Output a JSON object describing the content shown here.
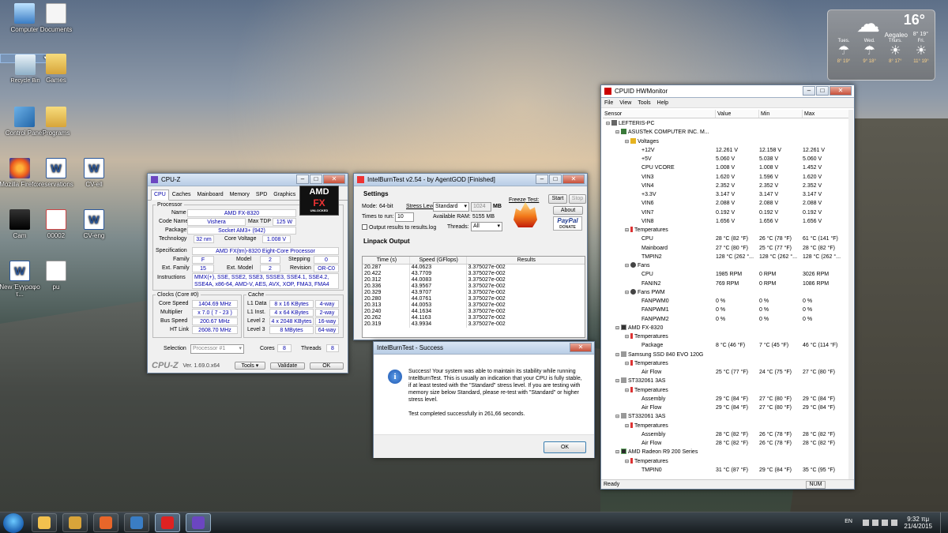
{
  "desktop": {
    "icons": [
      {
        "label": "Computer"
      },
      {
        "label": "Documents"
      },
      {
        "label": "Recycle Bin"
      },
      {
        "label": "Games"
      },
      {
        "label": "Control Panel"
      },
      {
        "label": "Programs"
      },
      {
        "label": "Mozilla Firefox"
      },
      {
        "label": "reservations"
      },
      {
        "label": "CV-ell"
      },
      {
        "label": "Cam"
      },
      {
        "label": "00002"
      },
      {
        "label": "CV-eng"
      },
      {
        "label": "New Έγγραφο τ..."
      },
      {
        "label": "pu"
      }
    ]
  },
  "weather": {
    "temp": "16°",
    "city": "Aegaleo",
    "minmax": "8° 19°",
    "days": [
      {
        "name": "Tues.",
        "temps": "8° 19°",
        "icon": "cloud-rain-icon"
      },
      {
        "name": "Wed.",
        "temps": "9° 18°",
        "icon": "cloud-rain-icon"
      },
      {
        "name": "Thurs.",
        "temps": "8° 17°",
        "icon": "sun-cloud-icon"
      },
      {
        "name": "Fri.",
        "temps": "11° 19°",
        "icon": "sun-cloud-icon"
      }
    ]
  },
  "cpuz": {
    "title": "CPU-Z",
    "tabs": [
      "CPU",
      "Caches",
      "Mainboard",
      "Memory",
      "SPD",
      "Graphics",
      "About"
    ],
    "processor_legend": "Processor",
    "labels": {
      "name": "Name",
      "codename": "Code Name",
      "maxtdp": "Max TDP",
      "package": "Package",
      "technology": "Technology",
      "corevoltage": "Core Voltage",
      "specification": "Specification",
      "family": "Family",
      "model": "Model",
      "stepping": "Stepping",
      "extfamily": "Ext. Family",
      "extmodel": "Ext. Model",
      "revision": "Revision",
      "instructions": "Instructions"
    },
    "values": {
      "name": "AMD FX-8320",
      "codename": "Vishera",
      "maxtdp": "125 W",
      "package": "Socket AM3+ (942)",
      "technology": "32 nm",
      "corevoltage": "1.008 V",
      "specification": "AMD FX(tm)-8320 Eight-Core Processor",
      "family": "F",
      "model": "2",
      "stepping": "0",
      "extfamily": "15",
      "extmodel": "2",
      "revision": "OR-C0",
      "instructions": "MMX(+), SSE, SSE2, SSE3, SSSE3, SSE4.1, SSE4.2, SSE4A, x86-64, AMD-V, AES, AVX, XOP, FMA3, FMA4"
    },
    "clocks_legend": "Clocks (Core #0)",
    "cache_legend": "Cache",
    "clocks": {
      "corespeed_label": "Core Speed",
      "corespeed": "1404.69 MHz",
      "multiplier_label": "Multiplier",
      "multiplier": "x 7.0 ( 7 - 23 )",
      "busspeed_label": "Bus Speed",
      "busspeed": "200.67 MHz",
      "htlink_label": "HT Link",
      "htlink": "2608.70 MHz"
    },
    "cache": {
      "l1d_label": "L1 Data",
      "l1d": "8 x 16 KBytes",
      "l1d_way": "4-way",
      "l1i_label": "L1 Inst.",
      "l1i": "4 x 64 KBytes",
      "l1i_way": "2-way",
      "l2_label": "Level 2",
      "l2": "4 x 2048 KBytes",
      "l2_way": "16-way",
      "l3_label": "Level 3",
      "l3": "8 MBytes",
      "l3_way": "64-way"
    },
    "selection_label": "Selection",
    "selection_value": "Processor #1",
    "cores_label": "Cores",
    "cores": "8",
    "threads_label": "Threads",
    "threads": "8",
    "brand": "CPU-Z",
    "version": "Ver. 1.69.0.x64",
    "tools_label": "Tools",
    "validate_label": "Validate",
    "ok_label": "OK",
    "logo_amd": "AMD",
    "logo_fx": "FX",
    "logo_sub": "UNLOCKED"
  },
  "ibt": {
    "title": "IntelBurnTest v2.54 - by AgentGOD [Finished]",
    "settings_title": "Settings",
    "mode_label": "Mode:",
    "mode_value": "64-bit",
    "stress_label": "Stress Level:",
    "stress_value": "Standard",
    "mem_value": "1024",
    "mem_unit": "MB",
    "times_label": "Times to run:",
    "times_value": "10",
    "ram_label": "Available RAM:",
    "ram_value": "5155 MB",
    "threads_label": "Threads:",
    "threads_value": "All",
    "output_check_label": "Output results to results.log",
    "freeze_label": "Freeze Test:",
    "start_label": "Start",
    "stop_label": "Stop",
    "about_label": "About",
    "paypal_label": "PayPal",
    "donate_label": "DONATE",
    "linpack_title": "Linpack Output",
    "columns": [
      "Time (s)",
      "Speed (GFlops)",
      "Results"
    ],
    "rows": [
      [
        "20.287",
        "44.0623",
        "3.375027e-002"
      ],
      [
        "20.422",
        "43.7709",
        "3.375027e-002"
      ],
      [
        "20.312",
        "44.0083",
        "3.375027e-002"
      ],
      [
        "20.336",
        "43.9567",
        "3.375027e-002"
      ],
      [
        "20.329",
        "43.9707",
        "3.375027e-002"
      ],
      [
        "20.280",
        "44.0761",
        "3.375027e-002"
      ],
      [
        "20.313",
        "44.0053",
        "3.375027e-002"
      ],
      [
        "20.240",
        "44.1634",
        "3.375027e-002"
      ],
      [
        "20.262",
        "44.1163",
        "3.375027e-002"
      ],
      [
        "20.319",
        "43.9934",
        "3.375027e-002"
      ]
    ]
  },
  "dialog": {
    "title": "IntelBurnTest - Success",
    "message": "Success! Your system was able to maintain its stability while running IntelBurnTest. This is usually an indication that your CPU is fully stable, if at least tested with the \"Standard\" stress level. If you are testing with memory size below Standard, please re-test with \"Standard\" or higher stress level.",
    "completion": "Test completed successfully in 261,66 seconds.",
    "ok_label": "OK"
  },
  "hwmonitor": {
    "title": "CPUID HWMonitor",
    "menu": [
      "File",
      "View",
      "Tools",
      "Help"
    ],
    "columns": [
      "Sensor",
      "Value",
      "Min",
      "Max"
    ],
    "rows": [
      {
        "indent": 0,
        "icon": "pc",
        "name": "LEFTERIS-PC",
        "value": "",
        "min": "",
        "max": ""
      },
      {
        "indent": 1,
        "icon": "board",
        "name": "ASUSTeK COMPUTER INC. M...",
        "value": "",
        "min": "",
        "max": ""
      },
      {
        "indent": 2,
        "icon": "volt",
        "name": "Voltages",
        "value": "",
        "min": "",
        "max": ""
      },
      {
        "indent": 3,
        "icon": "",
        "name": "+12V",
        "value": "12.261 V",
        "min": "12.158 V",
        "max": "12.261 V"
      },
      {
        "indent": 3,
        "icon": "",
        "name": "+5V",
        "value": "5.060 V",
        "min": "5.038 V",
        "max": "5.060 V"
      },
      {
        "indent": 3,
        "icon": "",
        "name": "CPU VCORE",
        "value": "1.008 V",
        "min": "1.008 V",
        "max": "1.452 V"
      },
      {
        "indent": 3,
        "icon": "",
        "name": "VIN3",
        "value": "1.620 V",
        "min": "1.596 V",
        "max": "1.620 V"
      },
      {
        "indent": 3,
        "icon": "",
        "name": "VIN4",
        "value": "2.352 V",
        "min": "2.352 V",
        "max": "2.352 V"
      },
      {
        "indent": 3,
        "icon": "",
        "name": "+3.3V",
        "value": "3.147 V",
        "min": "3.147 V",
        "max": "3.147 V"
      },
      {
        "indent": 3,
        "icon": "",
        "name": "VIN6",
        "value": "2.088 V",
        "min": "2.088 V",
        "max": "2.088 V"
      },
      {
        "indent": 3,
        "icon": "",
        "name": "VIN7",
        "value": "0.192 V",
        "min": "0.192 V",
        "max": "0.192 V"
      },
      {
        "indent": 3,
        "icon": "",
        "name": "VIN8",
        "value": "1.656 V",
        "min": "1.656 V",
        "max": "1.656 V"
      },
      {
        "indent": 2,
        "icon": "temp",
        "name": "Temperatures",
        "value": "",
        "min": "",
        "max": ""
      },
      {
        "indent": 3,
        "icon": "",
        "name": "CPU",
        "value": "28 °C (82 °F)",
        "min": "26 °C (78 °F)",
        "max": "61 °C (141 °F)"
      },
      {
        "indent": 3,
        "icon": "",
        "name": "Mainboard",
        "value": "27 °C (80 °F)",
        "min": "25 °C (77 °F)",
        "max": "28 °C (82 °F)"
      },
      {
        "indent": 3,
        "icon": "",
        "name": "TMPIN2",
        "value": "128 °C (262 °...",
        "min": "128 °C (262 °...",
        "max": "128 °C (262 °..."
      },
      {
        "indent": 2,
        "icon": "fan",
        "name": "Fans",
        "value": "",
        "min": "",
        "max": ""
      },
      {
        "indent": 3,
        "icon": "",
        "name": "CPU",
        "value": "1985 RPM",
        "min": "0 RPM",
        "max": "3026 RPM"
      },
      {
        "indent": 3,
        "icon": "",
        "name": "FANIN2",
        "value": "769 RPM",
        "min": "0 RPM",
        "max": "1086 RPM"
      },
      {
        "indent": 2,
        "icon": "fan",
        "name": "Fans PWM",
        "value": "",
        "min": "",
        "max": ""
      },
      {
        "indent": 3,
        "icon": "",
        "name": "FANPWM0",
        "value": "0 %",
        "min": "0 %",
        "max": "0 %"
      },
      {
        "indent": 3,
        "icon": "",
        "name": "FANPWM1",
        "value": "0 %",
        "min": "0 %",
        "max": "0 %"
      },
      {
        "indent": 3,
        "icon": "",
        "name": "FANPWM2",
        "value": "0 %",
        "min": "0 %",
        "max": "0 %"
      },
      {
        "indent": 1,
        "icon": "chip",
        "name": "AMD FX-8320",
        "value": "",
        "min": "",
        "max": ""
      },
      {
        "indent": 2,
        "icon": "temp",
        "name": "Temperatures",
        "value": "",
        "min": "",
        "max": ""
      },
      {
        "indent": 3,
        "icon": "",
        "name": "Package",
        "value": "8 °C (46 °F)",
        "min": "7 °C (45 °F)",
        "max": "46 °C (114 °F)"
      },
      {
        "indent": 1,
        "icon": "disk",
        "name": "Samsung SSD 840 EVO 120G",
        "value": "",
        "min": "",
        "max": ""
      },
      {
        "indent": 2,
        "icon": "temp",
        "name": "Temperatures",
        "value": "",
        "min": "",
        "max": ""
      },
      {
        "indent": 3,
        "icon": "",
        "name": "Air Flow",
        "value": "25 °C (77 °F)",
        "min": "24 °C (75 °F)",
        "max": "27 °C (80 °F)"
      },
      {
        "indent": 1,
        "icon": "disk",
        "name": "ST332061 3AS",
        "value": "",
        "min": "",
        "max": ""
      },
      {
        "indent": 2,
        "icon": "temp",
        "name": "Temperatures",
        "value": "",
        "min": "",
        "max": ""
      },
      {
        "indent": 3,
        "icon": "",
        "name": "Assembly",
        "value": "29 °C (84 °F)",
        "min": "27 °C (80 °F)",
        "max": "29 °C (84 °F)"
      },
      {
        "indent": 3,
        "icon": "",
        "name": "Air Flow",
        "value": "29 °C (84 °F)",
        "min": "27 °C (80 °F)",
        "max": "29 °C (84 °F)"
      },
      {
        "indent": 1,
        "icon": "disk",
        "name": "ST332061 3AS",
        "value": "",
        "min": "",
        "max": ""
      },
      {
        "indent": 2,
        "icon": "temp",
        "name": "Temperatures",
        "value": "",
        "min": "",
        "max": ""
      },
      {
        "indent": 3,
        "icon": "",
        "name": "Assembly",
        "value": "28 °C (82 °F)",
        "min": "26 °C (78 °F)",
        "max": "28 °C (82 °F)"
      },
      {
        "indent": 3,
        "icon": "",
        "name": "Air Flow",
        "value": "28 °C (82 °F)",
        "min": "26 °C (78 °F)",
        "max": "28 °C (82 °F)"
      },
      {
        "indent": 1,
        "icon": "gpu",
        "name": "AMD Radeon R9 200 Series",
        "value": "",
        "min": "",
        "max": ""
      },
      {
        "indent": 2,
        "icon": "temp",
        "name": "Temperatures",
        "value": "",
        "min": "",
        "max": ""
      },
      {
        "indent": 3,
        "icon": "",
        "name": "TMPIN0",
        "value": "31 °C (87 °F)",
        "min": "29 °C (84 °F)",
        "max": "35 °C (95 °F)"
      }
    ],
    "status": "Ready",
    "num": "NUM"
  },
  "taskbar": {
    "apps": [
      "explorer-icon",
      "folder-icon",
      "firefox-icon",
      "remote-desktop-icon",
      "intelburntest-icon",
      "cpuz-icon"
    ],
    "lang": "EN",
    "time": "9:32 πμ",
    "date": "21/4/2015"
  }
}
